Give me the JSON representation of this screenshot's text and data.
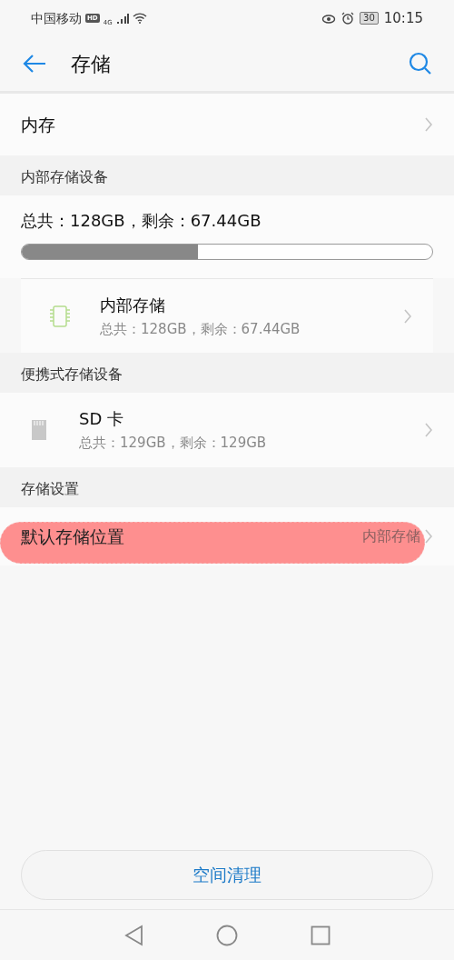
{
  "status_bar": {
    "carrier": "中国移动",
    "hd": "HD",
    "network": "4G",
    "battery": "30",
    "time": "10:15"
  },
  "header": {
    "title": "存储"
  },
  "memory_row": {
    "label": "内存"
  },
  "sections": [
    {
      "title": "内部存储设备",
      "summary": "总共：128GB，剩余：67.44GB",
      "usage": {
        "level": 0.43
      },
      "devices": [
        {
          "kind": "chip",
          "name": "内部存储",
          "detail": "总共：128GB，剩余：67.44GB"
        }
      ]
    },
    {
      "title": "便携式存储设备",
      "devices": [
        {
          "kind": "sdcard",
          "name": "SD 卡",
          "detail": "总共：129GB，剩余：129GB"
        }
      ]
    },
    {
      "title": "存储设置",
      "settings": [
        {
          "label": "默认存储位置",
          "value": "内部存储",
          "highlighted": true
        }
      ]
    }
  ],
  "clean_button": "空间清理"
}
